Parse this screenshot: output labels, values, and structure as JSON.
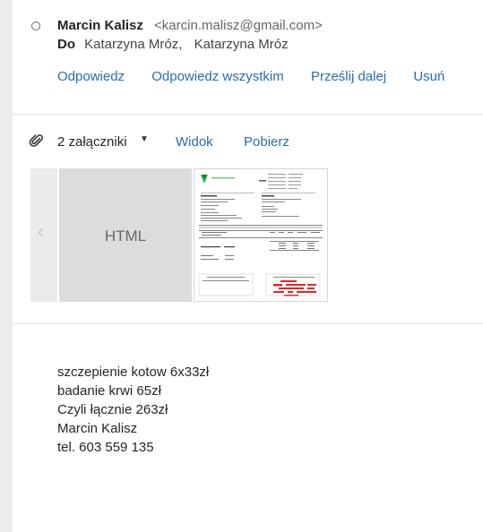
{
  "email": {
    "sender_name": "Marcin Kalisz",
    "sender_email": "<karcin.malisz@gmail.com>",
    "to_label": "Do",
    "recipients": [
      "Katarzyna Mróz,",
      "Katarzyna Mróz"
    ]
  },
  "actions": {
    "reply": "Odpowiedz",
    "reply_all": "Odpowiedz wszystkim",
    "forward": "Prześlij dalej",
    "delete": "Usuń"
  },
  "attachments": {
    "count_label": "2 załączniki",
    "view": "Widok",
    "download": "Pobierz",
    "items": [
      {
        "type_label": "HTML"
      },
      {
        "type_label": ""
      }
    ]
  },
  "body": {
    "lines": [
      "szczepienie kotow 6x33zł",
      "badanie krwi 65zł",
      "Czyli łącznie 263zł",
      "Marcin Kalisz",
      "tel. 603 559 135"
    ]
  },
  "icons": {
    "paperclip": "paperclip-icon",
    "carousel_prev": "chevron-left-icon",
    "dropdown": "caret-down-icon",
    "unread": "radio-circle-icon"
  },
  "colors": {
    "link": "#2a6cb0",
    "text": "#252525",
    "divider": "#e1e1e1",
    "stamp": "#e0282b"
  }
}
